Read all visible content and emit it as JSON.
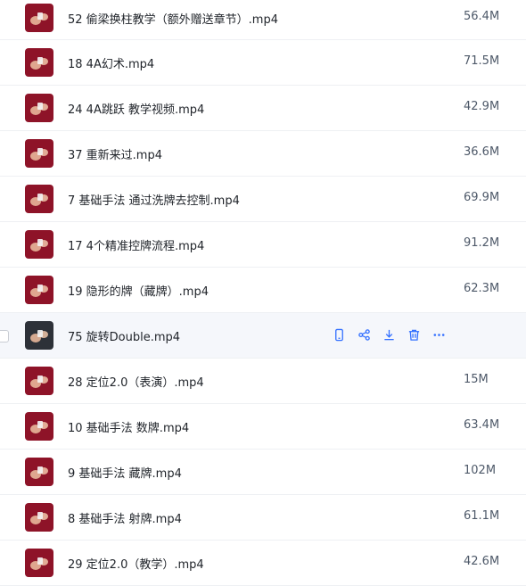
{
  "files": [
    {
      "name": "52 偷梁换柱教学（额外赠送章节）.mp4",
      "size": "56.4M",
      "thumb": "red"
    },
    {
      "name": "18 4A幻术.mp4",
      "size": "71.5M",
      "thumb": "red"
    },
    {
      "name": "24 4A跳跃 教学视频.mp4",
      "size": "42.9M",
      "thumb": "red"
    },
    {
      "name": "37 重新来过.mp4",
      "size": "36.6M",
      "thumb": "red"
    },
    {
      "name": "7 基础手法 通过洗牌去控制.mp4",
      "size": "69.9M",
      "thumb": "red"
    },
    {
      "name": "17 4个精准控牌流程.mp4",
      "size": "91.2M",
      "thumb": "red"
    },
    {
      "name": "19 隐形的牌（藏牌）.mp4",
      "size": "62.3M",
      "thumb": "red"
    },
    {
      "name": "75 旋转Double.mp4",
      "size": "",
      "thumb": "dark",
      "hovered": true
    },
    {
      "name": "28 定位2.0（表演）.mp4",
      "size": "15M",
      "thumb": "red"
    },
    {
      "name": "10 基础手法 数牌.mp4",
      "size": "63.4M",
      "thumb": "red"
    },
    {
      "name": "9 基础手法 藏牌.mp4",
      "size": "102M",
      "thumb": "red"
    },
    {
      "name": "8 基础手法 射牌.mp4",
      "size": "61.1M",
      "thumb": "red"
    },
    {
      "name": "29 定位2.0（教学）.mp4",
      "size": "42.6M",
      "thumb": "red"
    }
  ],
  "row_actions": [
    "phone-icon",
    "share-icon",
    "download-icon",
    "delete-icon",
    "more-icon"
  ],
  "colors": {
    "accent": "#3370ff",
    "thumb_red": "#8e1328",
    "thumb_dark": "#2d3138",
    "hover_bg": "#f5f7fb"
  }
}
